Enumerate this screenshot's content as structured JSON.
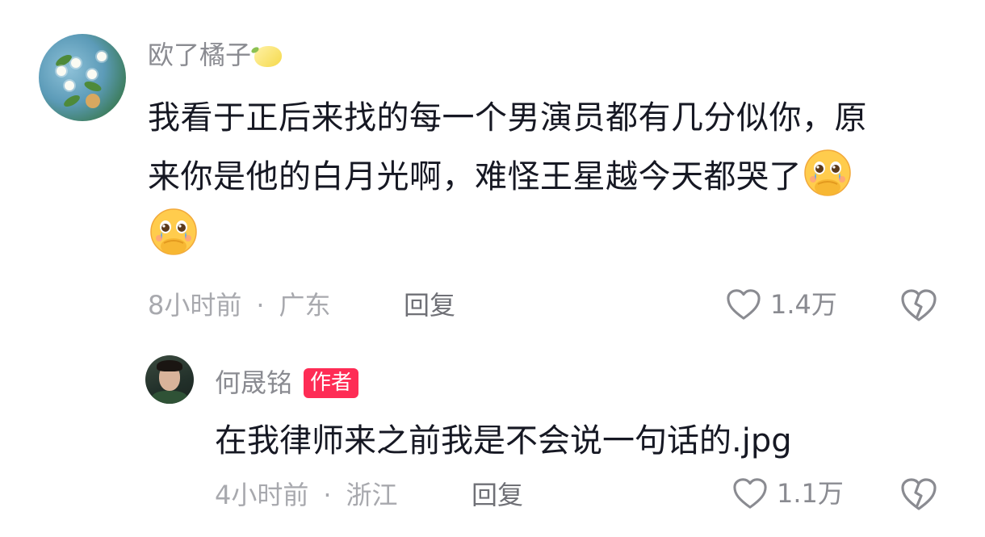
{
  "comment": {
    "username": "欧了橘子",
    "username_emoji": "lemon-icon",
    "text_line1": "我看于正后来找的每一个男演员都有几分似你，原",
    "text_line2": "来你是他的白月光啊，难怪王星越今天都哭了",
    "emoji": "crying-holding-back-tears-emoji",
    "time": "8小时前",
    "separator": "·",
    "location": "广东",
    "reply_label": "回复",
    "like_count": "1.4万"
  },
  "reply": {
    "username": "何晟铭",
    "badge": "作者",
    "text": "在我律师来之前我是不会说一句话的.jpg",
    "time": "4小时前",
    "separator": "·",
    "location": "浙江",
    "reply_label": "回复",
    "like_count": "1.1万"
  },
  "colors": {
    "badge_bg": "#fe2c55",
    "meta_text": "#a8a9ae",
    "username_text": "#8a8b91",
    "body_text": "#161823"
  }
}
